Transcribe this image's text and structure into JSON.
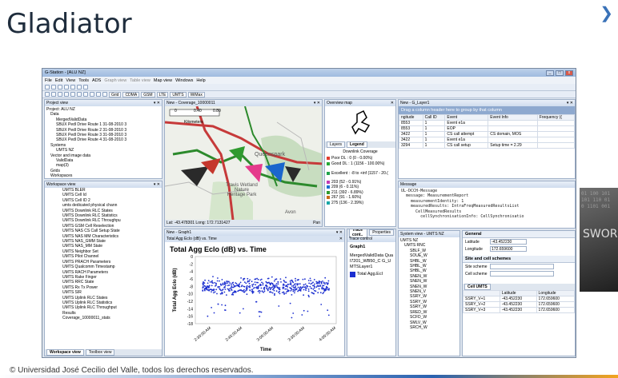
{
  "slide": {
    "title": "Gladiator",
    "footer": "© Universidad José Cecilio del Valle, todos los derechos reservados.",
    "deco_text": "SWOR"
  },
  "app": {
    "title": "G-Station - [ALU NZ]",
    "menu": [
      "File",
      "Edit",
      "View",
      "Tools",
      "ADS",
      "Graph view",
      "Table view",
      "Map view",
      "Windows",
      "Help"
    ],
    "toolbar": {
      "grid": "Grid",
      "cdma": "CDMA",
      "gsm": "GSM",
      "lte": "LTE",
      "umts": "UMTS",
      "wimax": "WiMax"
    }
  },
  "project": {
    "header": "Project view",
    "items": [
      "Project: ALU NZ",
      "Data",
      "MergedValidData",
      "SBUX Pedl Drive Route 1 31-08-2010 3",
      "SBUX Pedl Drive Route 2 31-08-2010 3",
      "SBUX Pedl Drive Route 3 31-08-2010 3",
      "SBUX Pedl Drive Route 4 31-08-2010 3",
      "Systems",
      "UMTS NZ",
      "Vector and image data",
      "ValidData",
      "map(3)",
      "Grids",
      "Workspaces"
    ]
  },
  "workspace": {
    "header": "Workspace view",
    "items": [
      "UMTS BLER",
      "UMTS Cell Id",
      "UMTS Cell ID 2",
      "umts dedicated physical chann",
      "UMTS Downlink RLC States",
      "UMTS Downlink RLC Statistics",
      "UMTS Downlink RLC Throughpu",
      "UMTS GSM Cell Reselection",
      "UMTS NAS CS Call Setup State",
      "UMTS NAS MM Characteristics",
      "UMTS NAS_GMM State",
      "UMTS NAS_MM State",
      "UMTS Neighbor Set",
      "UMTS Pilot Channel",
      "UMTS PRACH Parameters",
      "UMTS Qualcomm Timestamp",
      "UMTS RACH Parameters",
      "UMTS Rake Finger",
      "UMTS RRC State",
      "UMTS Rx Tx Power",
      "UMTS SIR",
      "UMTS Uplink RLC States",
      "UMTS Uplink RLC Statistics",
      "UMTS Uplink RLC Throughput",
      "Results",
      "Coverage_10000011_stats"
    ],
    "bottom_tabs": [
      "Workspace view",
      "Toolbox view"
    ]
  },
  "map": {
    "tab": "New - Coverage_10000011",
    "scale": [
      "0",
      "0.40",
      "0.80"
    ],
    "scale_unit": "Kilometers",
    "status": "Lat: -43.478301 Long: 172.7131427",
    "pan": "Pan",
    "labels": [
      "Travis Wetland Nature Heritage Park",
      "Queenspark",
      "Avon"
    ]
  },
  "overview": {
    "header": "Overview map",
    "tabs": [
      "Layers",
      "Legend"
    ],
    "legend_title": "Downlink Coverage",
    "legend": [
      "Poor DL : 0 (0 - 0.00%)",
      "Good DL : 1 (1156 - 100.00%)",
      "Excellent : -8 to +inf (1157 - 20.(",
      "203 (52 - 0.91%)",
      "209 (6 - 0.11%)",
      "211 (392 - 6.89%)",
      "267 (91 - 1.60%)",
      "275 (136 - 2.39%)"
    ],
    "colors": [
      "#e23b2e",
      "#25a836",
      "#1fa34b",
      "#c23bb5",
      "#1a6fd0",
      "#2f9a2f",
      "#c86a1a",
      "#1aa6a6"
    ]
  },
  "events": {
    "tab": "New - G_Layer1",
    "group_hint": "Drag a column header here to group by that column",
    "columns": [
      "ngitude",
      "Call ID",
      "Event",
      "Event Info",
      "Frequency (("
    ],
    "rows": [
      [
        "8553",
        "1",
        "Event e1a",
        ""
      ],
      [
        "8553",
        "1",
        "EOP",
        ""
      ],
      [
        "3422",
        "1",
        "CS call attempt",
        "CS domain, MOS"
      ],
      [
        "3422",
        "1",
        "Event e1a",
        ""
      ],
      [
        "3294",
        "1",
        "CS call setup",
        "Setup time = 2.29"
      ]
    ]
  },
  "message": {
    "header": "Message",
    "lines": [
      "UL-DCCH-Message",
      "  message: MeasurementReport",
      "    measurementIdentity: 1",
      "    measuredResults: IntraFreqMeasuredResultsList",
      "      CellMeasuredResults",
      "        cellSynchronisationInfo: CellSynchronisatio"
    ]
  },
  "graph": {
    "tab": "New - Graph1",
    "header": "Total Agg EcIo (dB) vs. Time"
  },
  "trace": {
    "tabs": [
      "Trace cont..",
      "Properties"
    ],
    "header": "Trace control",
    "graph": "Graph1",
    "item": "MergedValidData Qual7201_WB50_C G_UMTSLayer1",
    "legend": "Total Agg.EcI"
  },
  "system": {
    "tab": "System view - UMTS NZ",
    "items": [
      "UMTS NZ",
      "UMTS RNC",
      "SBLF_W",
      "SOUE_W",
      "SHBL_W",
      "SHBL_W",
      "SHBL_W",
      "SNEN_W",
      "SNEN_W",
      "SNEN_W",
      "SNEN_V",
      "SSRY_W",
      "SSRY_W",
      "SSRY_W",
      "SRED_W",
      "SCFD_W",
      "SMLV_W",
      "SRCH_W"
    ]
  },
  "general": {
    "header": "General",
    "latitude_label": "Latitude",
    "latitude": "-43.452230",
    "longitude_label": "Longitude",
    "longitude": "172.659600",
    "site_header": "Site and cell schemes",
    "site_label": "Site scheme",
    "cell_label": "Cell scheme",
    "cell_tab": "Cell UMTS",
    "table_cols": [
      "",
      "Latitude",
      "Longitude"
    ],
    "table_rows": [
      [
        "SSRY_V+1",
        "-43.452230",
        "172.659600"
      ],
      [
        "SSRY_V+2",
        "-43.452230",
        "172.659600"
      ],
      [
        "SSRY_V+3",
        "-43.452230",
        "172.659600"
      ]
    ]
  },
  "chart_data": {
    "type": "scatter",
    "title": "Total Agg EcIo (dB) vs. Time",
    "xlabel": "Time",
    "ylabel": "Total Agg EcIo (dB)",
    "ylim": [
      -18,
      0
    ],
    "y_ticks": [
      "0",
      "-2",
      "-4",
      "-6",
      "-8",
      "-10",
      "-12",
      "-14",
      "-16",
      "-18"
    ],
    "x_ticks": [
      "2:30:00 AM",
      "2:45:00 AM",
      "3:00:00 AM",
      "3:30:00 AM",
      "4:00:00 AM"
    ],
    "series": [
      {
        "color": "#1c2fd0",
        "x_range": [
          0.05,
          0.95
        ],
        "y_band": [
          -11,
          -6
        ],
        "y_mean": -8
      }
    ]
  }
}
